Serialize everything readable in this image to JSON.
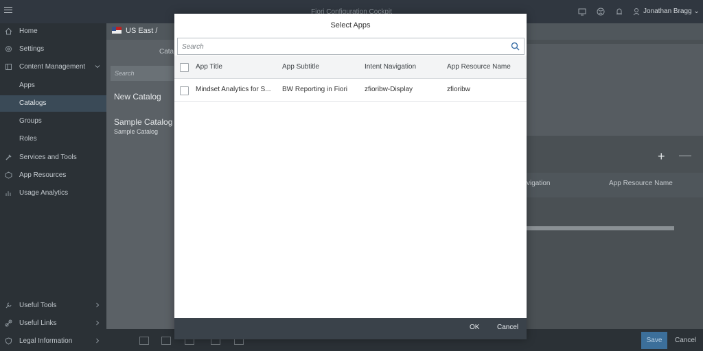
{
  "shell": {
    "title": "Fiori Configuration Cockpit",
    "user_name": "Jonathan Bragg"
  },
  "sidebar": {
    "items": [
      {
        "label": "Home",
        "icon": "home-icon"
      },
      {
        "label": "Settings",
        "icon": "gear-icon"
      },
      {
        "label": "Content Management",
        "icon": "content-icon"
      },
      {
        "label": "Apps"
      },
      {
        "label": "Catalogs"
      },
      {
        "label": "Groups"
      },
      {
        "label": "Roles"
      },
      {
        "label": "Services and Tools",
        "icon": "tools-icon"
      },
      {
        "label": "App Resources",
        "icon": "resources-icon"
      },
      {
        "label": "Usage Analytics",
        "icon": "analytics-icon"
      }
    ],
    "bottom_items": [
      {
        "label": "Useful Tools"
      },
      {
        "label": "Useful Links"
      },
      {
        "label": "Legal Information"
      }
    ]
  },
  "background": {
    "region": "US East /",
    "catalog_label": "Cata",
    "search_placeholder": "Search",
    "catalogs": [
      {
        "title": "New Catalog"
      },
      {
        "title": "Sample Catalog",
        "subtitle": "Sample Catalog"
      }
    ],
    "col_intent": "vigation",
    "col_resource": "App Resource Name",
    "save_label": "Save",
    "cancel_label": "Cancel"
  },
  "dialog": {
    "title": "Select Apps",
    "search_placeholder": "Search",
    "columns": [
      "App Title",
      "App Subtitle",
      "Intent Navigation",
      "App Resource Name"
    ],
    "rows": [
      {
        "title": "Mindset Analytics for S...",
        "subtitle": "BW Reporting in Fiori",
        "intent": "zfioribw-Display",
        "resource": "zfioribw"
      }
    ],
    "ok_label": "OK",
    "cancel_label": "Cancel"
  },
  "colors": {
    "shell": "#303740",
    "sidebar": "#2b3136",
    "sidebar_active": "#3a4a57",
    "dialog_footer": "#3a424a",
    "accent": "#3c6f9a"
  }
}
